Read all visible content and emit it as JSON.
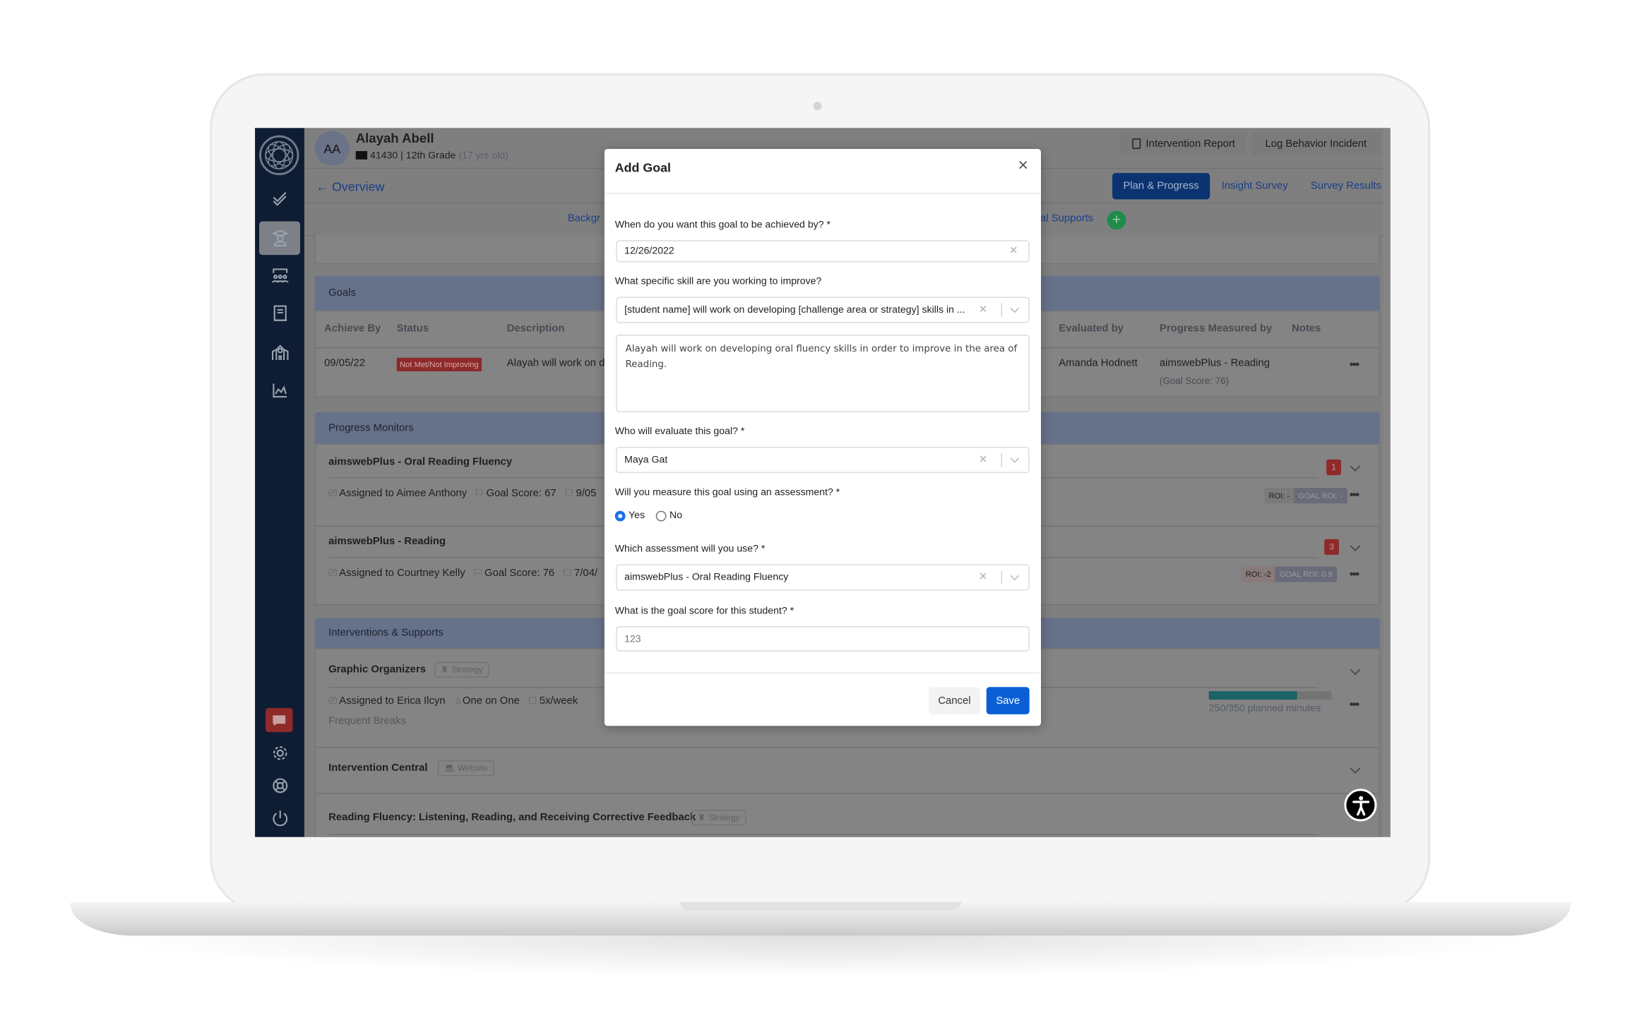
{
  "student": {
    "initials": "AA",
    "name": "Alayah Abell",
    "id": "41430",
    "grade": "12th Grade",
    "age": "(17 yrs old)"
  },
  "header": {
    "intervention_report": "Intervention Report",
    "log_behavior": "Log Behavior Incident"
  },
  "nav": {
    "back": "Overview",
    "tabs": [
      "Plan & Progress",
      "Insight Survey",
      "Survey Results"
    ],
    "active_tab": "Plan & Progress",
    "subtabs_visible": [
      "Backgr",
      "ntal Supports"
    ]
  },
  "sidebar": {
    "items": [
      "check-icon",
      "student-icon",
      "class-icon",
      "book-icon",
      "school-icon",
      "chart-icon"
    ],
    "bottom": [
      "chat-icon",
      "gear-icon",
      "lifebuoy-icon",
      "power-icon"
    ]
  },
  "goals": {
    "title": "Goals",
    "columns": [
      "Achieve By",
      "Status",
      "Description",
      "Evaluated by",
      "Progress Measured by",
      "Notes"
    ],
    "rows": [
      {
        "achieve_by": "09/05/22",
        "status": "Not Met/Not Improving",
        "description": "Alayah will work on d",
        "evaluated_by": "Amanda Hodnett",
        "measured_by": "aimswebPlus - Reading",
        "goal_score": "(Goal Score: 76)"
      }
    ]
  },
  "progress_monitors": {
    "title": "Progress Monitors",
    "items": [
      {
        "name": "aimswebPlus - Oral Reading Fluency",
        "assigned": "Assigned to Aimee Anthony",
        "goal_score": "Goal Score: 67",
        "date": "9/05",
        "count": "1",
        "roi": "ROI: -",
        "goal_roi": "GOAL ROI: -"
      },
      {
        "name": "aimswebPlus - Reading",
        "assigned": "Assigned to Courtney Kelly",
        "goal_score": "Goal Score: 76",
        "date": "7/04/",
        "count": "3",
        "roi": "ROI: -2",
        "goal_roi": "GOAL ROI: 0.9"
      }
    ]
  },
  "interventions": {
    "title": "Interventions & Supports",
    "items": [
      {
        "name": "Graphic Organizers",
        "type": "Strategy",
        "assigned": "Assigned to Erica Ilcyn",
        "mode": "One on One",
        "frequency": "5x/week",
        "note": "Frequent Breaks",
        "progress_text": "250/350 planned minutes",
        "progress": 0.714
      },
      {
        "name": "Intervention Central",
        "type": "Website"
      },
      {
        "name": "Reading Fluency: Listening, Reading, and Receiving Corrective Feedback",
        "type": "Strategy"
      }
    ]
  },
  "modal": {
    "title": "Add Goal",
    "q_date": "When do you want this goal to be achieved by? *",
    "date_value": "12/26/2022",
    "q_skill": "What specific skill are you working to improve?",
    "skill_value": "[student name] will work on developing [challenge area or strategy] skills in ...",
    "goal_text": "Alayah will work on developing oral fluency skills in order to improve in the area of Reading.",
    "q_evaluator": "Who will evaluate this goal? *",
    "evaluator_value": "Maya Gat",
    "q_assessment": "Will you measure this goal using an assessment? *",
    "yes": "Yes",
    "no": "No",
    "assessment_selected": "Yes",
    "q_which": "Which assessment will you use? *",
    "which_value": "aimswebPlus - Oral Reading Fluency",
    "q_score": "What is the goal score for this student? *",
    "score_placeholder": "123",
    "cancel": "Cancel",
    "save": "Save"
  },
  "colors": {
    "sidebar": "#0e1d33",
    "primary_button": "#0a5fd6",
    "active_tab": "#0a3370",
    "status_red": "#8e2a2a",
    "progress": "#1a6366",
    "add_green": "#1f8b4c"
  }
}
